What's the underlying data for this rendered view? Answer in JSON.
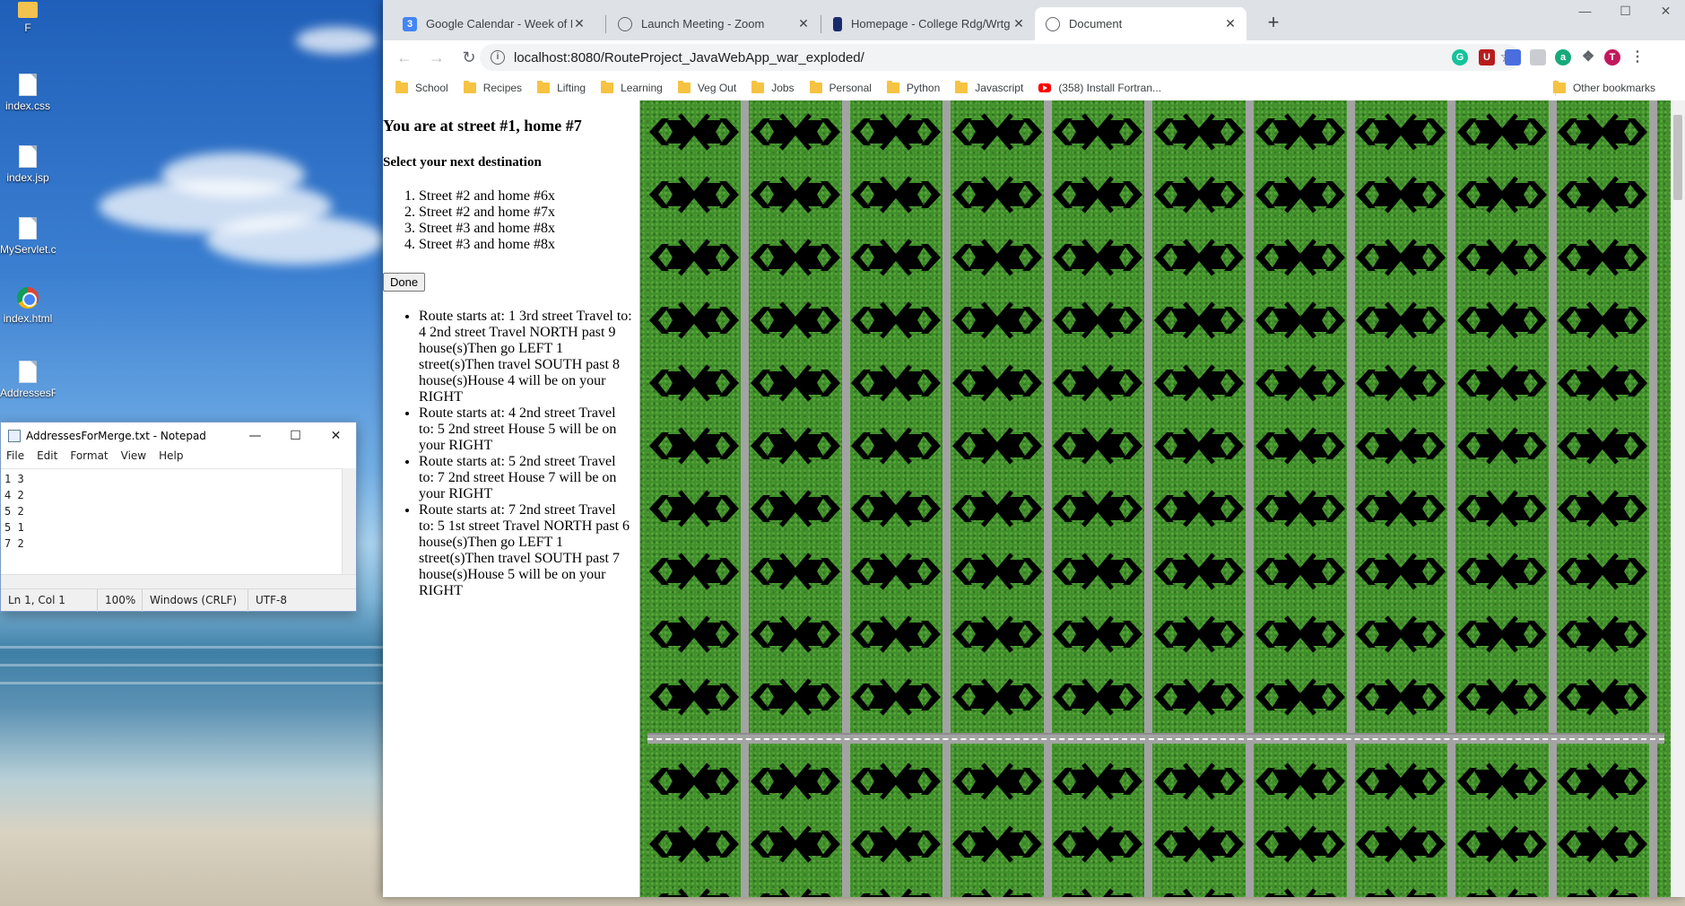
{
  "desktop": {
    "icons": [
      {
        "label": "F",
        "type": "folder"
      },
      {
        "label": "index.css",
        "type": "file"
      },
      {
        "label": "index.jsp",
        "type": "file"
      },
      {
        "label": "MyServlet.css",
        "type": "file"
      },
      {
        "label": "index.html",
        "type": "chrome"
      },
      {
        "label": "AddressesF...",
        "type": "file"
      }
    ]
  },
  "notepad": {
    "title": "AddressesForMerge.txt - Notepad",
    "menu": [
      "File",
      "Edit",
      "Format",
      "View",
      "Help"
    ],
    "lines": [
      "1  3",
      "4  2",
      "5  2",
      "5  1",
      "7  2"
    ],
    "status": {
      "position": "Ln 1, Col 1",
      "zoom": "100%",
      "line_ending": "Windows (CRLF)",
      "encoding": "UTF-8"
    }
  },
  "browser": {
    "tabs": [
      {
        "title": "Google Calendar - Week of Febru",
        "favicon_color": "#4285f4",
        "favicon_text": "3"
      },
      {
        "title": "Launch Meeting - Zoom",
        "favicon_color": "#5f6368",
        "favicon_text": ""
      },
      {
        "title": "Homepage - College Rdg/Wrtg I",
        "favicon_color": "#1a2b6d",
        "favicon_text": ""
      },
      {
        "title": "Document",
        "favicon_color": "#5f6368",
        "favicon_text": ""
      }
    ],
    "active_tab": 3,
    "url": "localhost:8080/RouteProject_JavaWebApp_war_exploded/",
    "profile_initial": "T",
    "bookmarks": [
      "School",
      "Recipes",
      "Lifting",
      "Learning",
      "Veg Out",
      "Jobs",
      "Personal",
      "Python",
      "Javascript"
    ],
    "youtube_bookmark": "(358) Install Fortran...",
    "other_bookmarks": "Other bookmarks"
  },
  "page": {
    "heading": "You are at street #1, home #7",
    "subheading": "Select your next destination",
    "destinations": [
      "Street #2 and home #6x",
      "Street #2 and home #7x",
      "Street #3 and home #8x",
      "Street #3 and home #8x"
    ],
    "done_label": "Done",
    "routes": [
      "Route starts at: 1 3rd street Travel to: 4 2nd street Travel NORTH past 9 house(s)Then go LEFT 1 street(s)Then travel SOUTH past 8 house(s)House 4 will be on your RIGHT",
      "Route starts at: 4 2nd street Travel to: 5 2nd street House 5 will be on your RIGHT",
      "Route starts at: 5 2nd street Travel to: 7 2nd street House 7 will be on your RIGHT",
      "Route starts at: 7 2nd street Travel to: 5 1st street Travel NORTH past 6 house(s)Then go LEFT 1 street(s)Then travel SOUTH past 7 house(s)House 5 will be on your RIGHT"
    ]
  }
}
